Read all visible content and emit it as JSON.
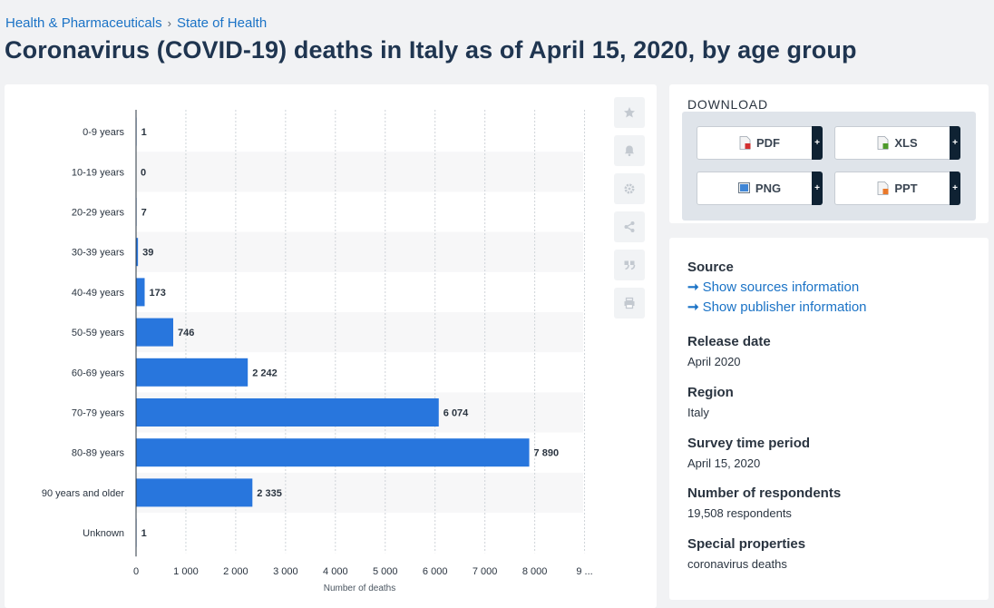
{
  "breadcrumb": {
    "items": [
      "Health & Pharmaceuticals",
      "State of Health"
    ],
    "separator": "›"
  },
  "page_title": "Coronavirus (COVID-19) deaths in Italy as of April 15, 2020, by age group",
  "download": {
    "title": "DOWNLOAD",
    "buttons": [
      {
        "label": "PDF",
        "icon": "pdf-file-icon",
        "plus": "+"
      },
      {
        "label": "XLS",
        "icon": "xls-file-icon",
        "plus": "+"
      },
      {
        "label": "PNG",
        "icon": "png-file-icon",
        "plus": "+"
      },
      {
        "label": "PPT",
        "icon": "ppt-file-icon",
        "plus": "+"
      }
    ]
  },
  "tools": [
    "star-icon",
    "bell-icon",
    "gear-icon",
    "share-icon",
    "quote-icon",
    "print-icon"
  ],
  "info": {
    "source_label": "Source",
    "show_sources": "Show sources information",
    "show_publisher": "Show publisher information",
    "release_label": "Release date",
    "release_value": "April 2020",
    "region_label": "Region",
    "region_value": "Italy",
    "period_label": "Survey time period",
    "period_value": "April 15, 2020",
    "respondents_label": "Number of respondents",
    "respondents_value": "19,508 respondents",
    "special_label": "Special properties",
    "special_value": "coronavirus deaths"
  },
  "colors": {
    "bar": "#2876dd",
    "link": "#1b73c6",
    "title": "#1f3550",
    "plus": "#0f2233"
  },
  "chart_data": {
    "type": "bar",
    "orientation": "horizontal",
    "categories": [
      "0-9 years",
      "10-19 years",
      "20-29 years",
      "30-39 years",
      "40-49 years",
      "50-59 years",
      "60-69 years",
      "70-79 years",
      "80-89 years",
      "90 years and older",
      "Unknown"
    ],
    "values": [
      1,
      0,
      7,
      39,
      173,
      746,
      2242,
      6074,
      7890,
      2335,
      1
    ],
    "value_labels": [
      "1",
      "0",
      "7",
      "39",
      "173",
      "746",
      "2 242",
      "6 074",
      "7 890",
      "2 335",
      "1"
    ],
    "x_ticks": [
      0,
      1000,
      2000,
      3000,
      4000,
      5000,
      6000,
      7000,
      8000,
      9000
    ],
    "x_tick_labels": [
      "0",
      "1 000",
      "2 000",
      "3 000",
      "4 000",
      "5 000",
      "6 000",
      "7 000",
      "8 000",
      "9 ..."
    ],
    "xlabel": "Number of deaths",
    "ylabel": "",
    "xlim": [
      0,
      9000
    ],
    "grid": true
  }
}
